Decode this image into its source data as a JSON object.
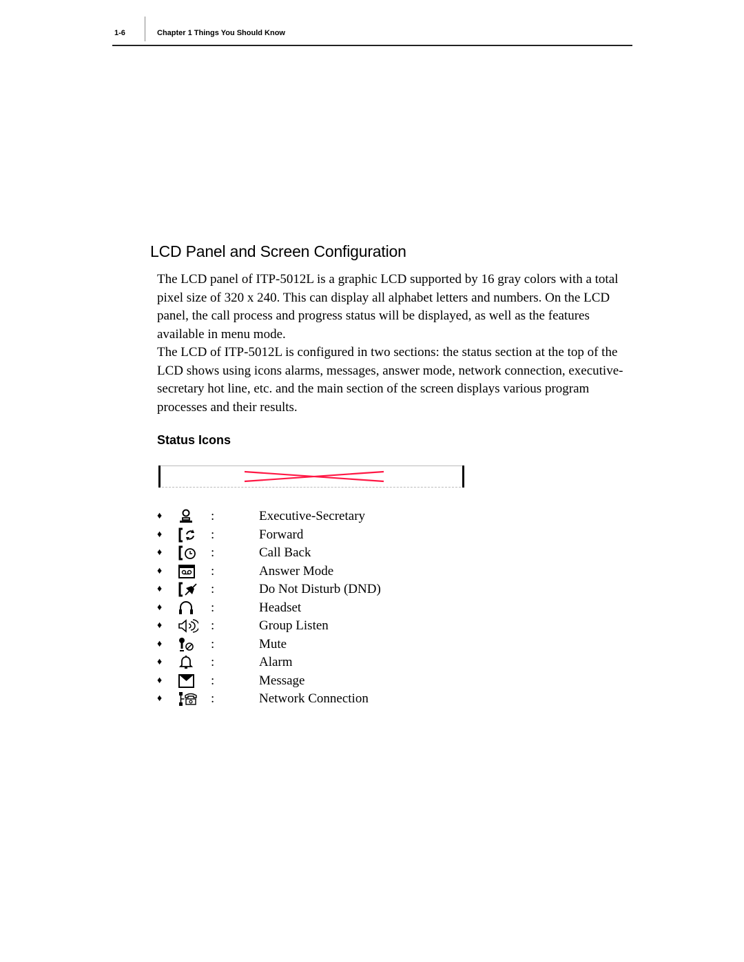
{
  "header": {
    "page_number": "1-6",
    "chapter_title": "Chapter 1  Things You Should Know"
  },
  "section": {
    "title": "LCD Panel and Screen Configuration",
    "paragraphs": [
      "The LCD panel of ITP-5012L is a graphic LCD supported by 16 gray colors with a total pixel size of 320 x 240. This can display all alphabet letters and numbers. On the LCD panel, the call process and progress status will be displayed, as well as the features available in menu mode.",
      "The LCD of ITP-5012L is configured in two sections: the status section at the top of the LCD shows using icons alarms, messages, answer mode, network connection, executive-secretary hot line, etc. and the main section of the screen displays various program processes and their results."
    ]
  },
  "status_icons": {
    "title": "Status Icons",
    "placeholder_color": "#ff1744",
    "bullet": "♦",
    "separator": ":",
    "items": [
      {
        "icon": "executive-secretary-icon",
        "label": "Executive-Secretary"
      },
      {
        "icon": "forward-icon",
        "label": "Forward"
      },
      {
        "icon": "call-back-icon",
        "label": "Call Back"
      },
      {
        "icon": "answer-mode-icon",
        "label": "Answer Mode"
      },
      {
        "icon": "do-not-disturb-icon",
        "label": "Do Not Disturb (DND)"
      },
      {
        "icon": "headset-icon",
        "label": "Headset"
      },
      {
        "icon": "group-listen-icon",
        "label": "Group Listen"
      },
      {
        "icon": "mute-icon",
        "label": "Mute"
      },
      {
        "icon": "alarm-icon",
        "label": "Alarm"
      },
      {
        "icon": "message-icon",
        "label": "Message"
      },
      {
        "icon": "network-connection-icon",
        "label": "Network Connection"
      }
    ]
  }
}
